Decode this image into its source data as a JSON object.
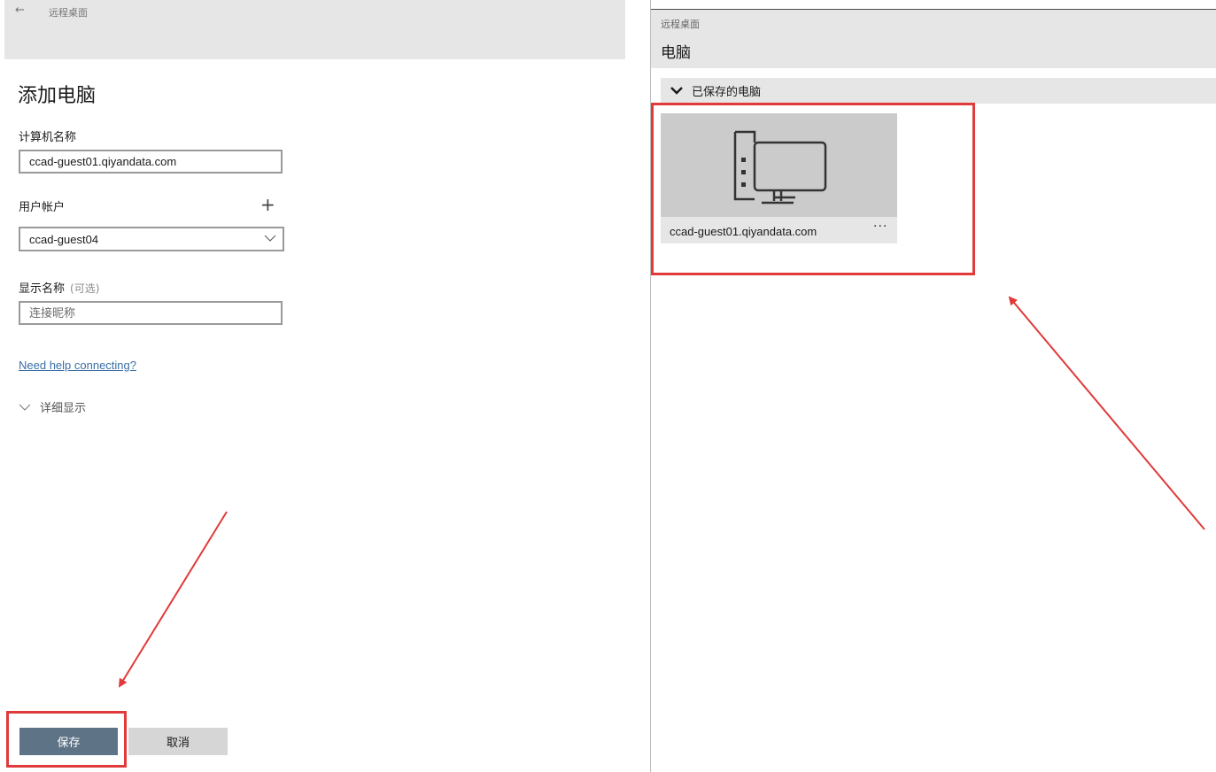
{
  "left": {
    "back_glyph": "←",
    "app_title": "远程桌面",
    "heading": "添加电脑",
    "computer_name": {
      "label": "计算机名称",
      "value": "ccad-guest01.qiyandata.com"
    },
    "user_account": {
      "label": "用户帐户",
      "selected": "ccad-guest04"
    },
    "display_name": {
      "label": "显示名称",
      "optional": "(可选)",
      "placeholder": "连接昵称"
    },
    "help_link": "Need help connecting?",
    "details_toggle": "详细显示",
    "save_label": "保存",
    "cancel_label": "取消"
  },
  "right": {
    "app_title": "远程桌面",
    "page_title": "电脑",
    "group_label": "已保存的电脑",
    "tile": {
      "name": "ccad-guest01.qiyandata.com",
      "more_label": "···"
    }
  },
  "icons": {
    "back": "arrow-left-icon",
    "plus": "plus-icon",
    "select": "chevron-down-icon",
    "details": "chevron-down-icon",
    "group": "chevron-down-icon",
    "pc": "desktop-computer-icon"
  },
  "colors": {
    "accent_button": "#5e7386",
    "annotation": "#e03a3a",
    "link": "#3a6fa8"
  }
}
